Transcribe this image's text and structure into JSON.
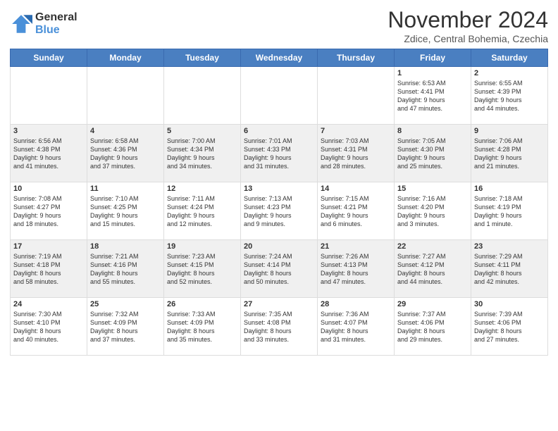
{
  "header": {
    "logo": {
      "general": "General",
      "blue": "Blue"
    },
    "title": "November 2024",
    "location": "Zdice, Central Bohemia, Czechia"
  },
  "calendar": {
    "days_of_week": [
      "Sunday",
      "Monday",
      "Tuesday",
      "Wednesday",
      "Thursday",
      "Friday",
      "Saturday"
    ],
    "weeks": [
      [
        {
          "day": "",
          "info": ""
        },
        {
          "day": "",
          "info": ""
        },
        {
          "day": "",
          "info": ""
        },
        {
          "day": "",
          "info": ""
        },
        {
          "day": "",
          "info": ""
        },
        {
          "day": "1",
          "info": "Sunrise: 6:53 AM\nSunset: 4:41 PM\nDaylight: 9 hours\nand 47 minutes."
        },
        {
          "day": "2",
          "info": "Sunrise: 6:55 AM\nSunset: 4:39 PM\nDaylight: 9 hours\nand 44 minutes."
        }
      ],
      [
        {
          "day": "3",
          "info": "Sunrise: 6:56 AM\nSunset: 4:38 PM\nDaylight: 9 hours\nand 41 minutes."
        },
        {
          "day": "4",
          "info": "Sunrise: 6:58 AM\nSunset: 4:36 PM\nDaylight: 9 hours\nand 37 minutes."
        },
        {
          "day": "5",
          "info": "Sunrise: 7:00 AM\nSunset: 4:34 PM\nDaylight: 9 hours\nand 34 minutes."
        },
        {
          "day": "6",
          "info": "Sunrise: 7:01 AM\nSunset: 4:33 PM\nDaylight: 9 hours\nand 31 minutes."
        },
        {
          "day": "7",
          "info": "Sunrise: 7:03 AM\nSunset: 4:31 PM\nDaylight: 9 hours\nand 28 minutes."
        },
        {
          "day": "8",
          "info": "Sunrise: 7:05 AM\nSunset: 4:30 PM\nDaylight: 9 hours\nand 25 minutes."
        },
        {
          "day": "9",
          "info": "Sunrise: 7:06 AM\nSunset: 4:28 PM\nDaylight: 9 hours\nand 21 minutes."
        }
      ],
      [
        {
          "day": "10",
          "info": "Sunrise: 7:08 AM\nSunset: 4:27 PM\nDaylight: 9 hours\nand 18 minutes."
        },
        {
          "day": "11",
          "info": "Sunrise: 7:10 AM\nSunset: 4:25 PM\nDaylight: 9 hours\nand 15 minutes."
        },
        {
          "day": "12",
          "info": "Sunrise: 7:11 AM\nSunset: 4:24 PM\nDaylight: 9 hours\nand 12 minutes."
        },
        {
          "day": "13",
          "info": "Sunrise: 7:13 AM\nSunset: 4:23 PM\nDaylight: 9 hours\nand 9 minutes."
        },
        {
          "day": "14",
          "info": "Sunrise: 7:15 AM\nSunset: 4:21 PM\nDaylight: 9 hours\nand 6 minutes."
        },
        {
          "day": "15",
          "info": "Sunrise: 7:16 AM\nSunset: 4:20 PM\nDaylight: 9 hours\nand 3 minutes."
        },
        {
          "day": "16",
          "info": "Sunrise: 7:18 AM\nSunset: 4:19 PM\nDaylight: 9 hours\nand 1 minute."
        }
      ],
      [
        {
          "day": "17",
          "info": "Sunrise: 7:19 AM\nSunset: 4:18 PM\nDaylight: 8 hours\nand 58 minutes."
        },
        {
          "day": "18",
          "info": "Sunrise: 7:21 AM\nSunset: 4:16 PM\nDaylight: 8 hours\nand 55 minutes."
        },
        {
          "day": "19",
          "info": "Sunrise: 7:23 AM\nSunset: 4:15 PM\nDaylight: 8 hours\nand 52 minutes."
        },
        {
          "day": "20",
          "info": "Sunrise: 7:24 AM\nSunset: 4:14 PM\nDaylight: 8 hours\nand 50 minutes."
        },
        {
          "day": "21",
          "info": "Sunrise: 7:26 AM\nSunset: 4:13 PM\nDaylight: 8 hours\nand 47 minutes."
        },
        {
          "day": "22",
          "info": "Sunrise: 7:27 AM\nSunset: 4:12 PM\nDaylight: 8 hours\nand 44 minutes."
        },
        {
          "day": "23",
          "info": "Sunrise: 7:29 AM\nSunset: 4:11 PM\nDaylight: 8 hours\nand 42 minutes."
        }
      ],
      [
        {
          "day": "24",
          "info": "Sunrise: 7:30 AM\nSunset: 4:10 PM\nDaylight: 8 hours\nand 40 minutes."
        },
        {
          "day": "25",
          "info": "Sunrise: 7:32 AM\nSunset: 4:09 PM\nDaylight: 8 hours\nand 37 minutes."
        },
        {
          "day": "26",
          "info": "Sunrise: 7:33 AM\nSunset: 4:09 PM\nDaylight: 8 hours\nand 35 minutes."
        },
        {
          "day": "27",
          "info": "Sunrise: 7:35 AM\nSunset: 4:08 PM\nDaylight: 8 hours\nand 33 minutes."
        },
        {
          "day": "28",
          "info": "Sunrise: 7:36 AM\nSunset: 4:07 PM\nDaylight: 8 hours\nand 31 minutes."
        },
        {
          "day": "29",
          "info": "Sunrise: 7:37 AM\nSunset: 4:06 PM\nDaylight: 8 hours\nand 29 minutes."
        },
        {
          "day": "30",
          "info": "Sunrise: 7:39 AM\nSunset: 4:06 PM\nDaylight: 8 hours\nand 27 minutes."
        }
      ]
    ]
  }
}
